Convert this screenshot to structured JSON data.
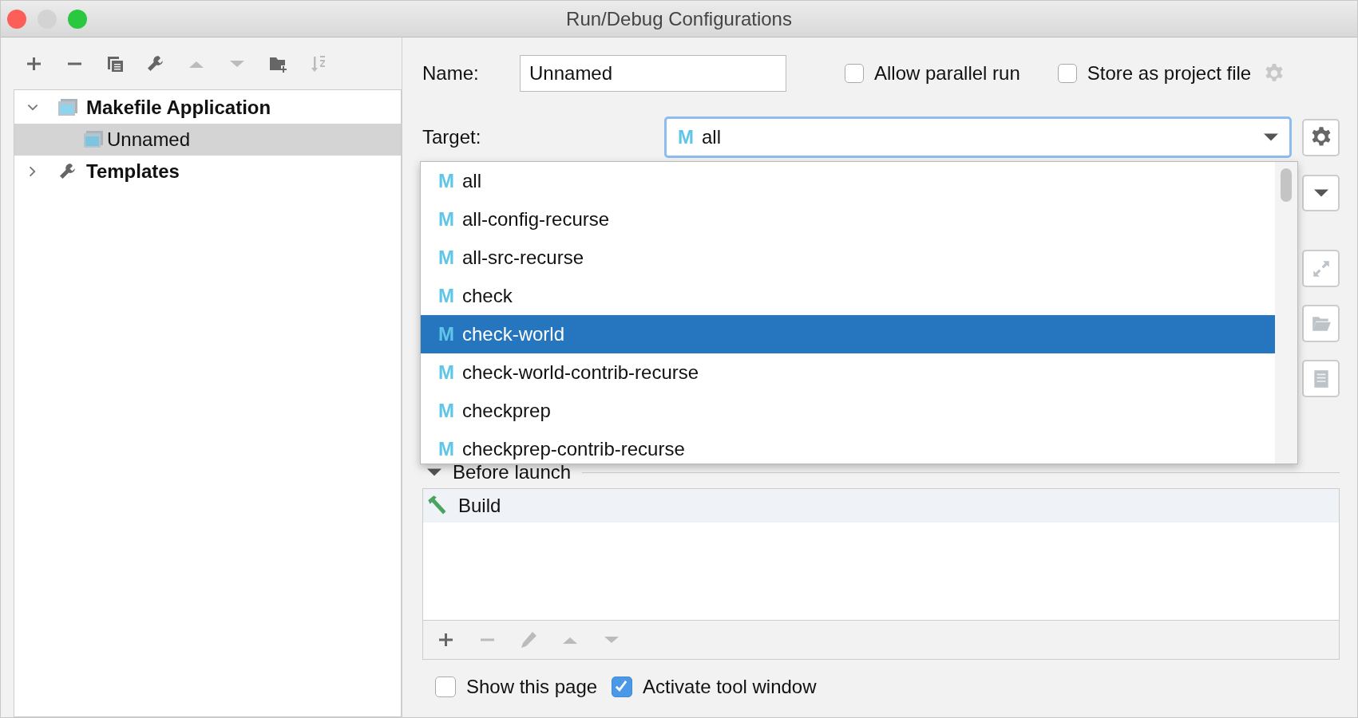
{
  "window": {
    "title": "Run/Debug Configurations"
  },
  "tree": [
    {
      "label": "Makefile Application",
      "expanded": true,
      "selected": false,
      "kind": "app",
      "children": [
        {
          "label": "Unnamed",
          "selected": true,
          "kind": "config"
        }
      ]
    },
    {
      "label": "Templates",
      "expanded": false,
      "selected": false,
      "kind": "templates"
    }
  ],
  "form": {
    "name_label": "Name:",
    "name_value": "Unnamed",
    "allow_parallel": {
      "label": "Allow parallel run",
      "checked": false
    },
    "store_project": {
      "label": "Store as project file",
      "checked": false
    },
    "target_label": "Target:",
    "target_badge": "M",
    "target_value": "all"
  },
  "target_options": [
    {
      "badge": "M",
      "label": "all",
      "selected": false
    },
    {
      "badge": "M",
      "label": "all-config-recurse",
      "selected": false
    },
    {
      "badge": "M",
      "label": "all-src-recurse",
      "selected": false
    },
    {
      "badge": "M",
      "label": "check",
      "selected": false
    },
    {
      "badge": "M",
      "label": "check-world",
      "selected": true
    },
    {
      "badge": "M",
      "label": "check-world-contrib-recurse",
      "selected": false
    },
    {
      "badge": "M",
      "label": "checkprep",
      "selected": false
    },
    {
      "badge": "M",
      "label": "checkprep-contrib-recurse",
      "selected": false
    }
  ],
  "before_launch": {
    "title": "Before launch",
    "tasks": [
      {
        "label": "Build"
      }
    ]
  },
  "options": [
    {
      "label": "Show this page",
      "checked": false
    },
    {
      "label": "Activate tool window",
      "checked": true
    }
  ]
}
